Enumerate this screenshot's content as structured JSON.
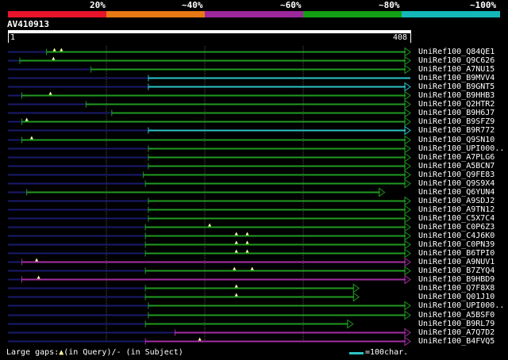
{
  "legend": {
    "labels": [
      "20%",
      "~40%",
      "~60%",
      "~80%",
      "~100%"
    ],
    "colors": [
      "#e8142c",
      "#e87814",
      "#9c289c",
      "#14a014",
      "#14b8b8"
    ]
  },
  "query": {
    "name": "AV410913",
    "start": "1",
    "end": "408",
    "length": 408
  },
  "colors": {
    "red": "#e8142c",
    "orange": "#e87814",
    "purple": "#a52ea5",
    "green": "#1f9a1f",
    "cyan": "#2cc3c8",
    "navy": "#1a1a6e",
    "marker": "#ffffa0"
  },
  "hits": [
    {
      "label": "UniRef100_Q84QE1",
      "color": "green",
      "start": 40,
      "end": 408,
      "arrow": "right",
      "markers": [
        48,
        55
      ]
    },
    {
      "label": "UniRef100_Q9C626",
      "color": "green",
      "start": 13,
      "end": 408,
      "arrow": "right",
      "markers": [
        47
      ]
    },
    {
      "label": "UniRef100_A7NU15",
      "color": "green",
      "start": 85,
      "end": 408,
      "arrow": "right",
      "markers": []
    },
    {
      "label": "UniRef100_B9MVV4",
      "color": "cyan",
      "start": 143,
      "end": 408,
      "arrow": "none",
      "markers": []
    },
    {
      "label": "UniRef100_B9GNT5",
      "color": "cyan",
      "start": 143,
      "end": 408,
      "arrow": "right",
      "markers": []
    },
    {
      "label": "UniRef100_B9HHB3",
      "color": "green",
      "start": 15,
      "end": 408,
      "arrow": "right",
      "markers": [
        44
      ]
    },
    {
      "label": "UniRef100_Q2HTR2",
      "color": "green",
      "start": 80,
      "end": 408,
      "arrow": "right",
      "markers": []
    },
    {
      "label": "UniRef100_B9H6J7",
      "color": "green",
      "start": 106,
      "end": 408,
      "arrow": "right",
      "markers": []
    },
    {
      "label": "UniRef100_B9SFZ9",
      "color": "green",
      "start": 15,
      "end": 408,
      "arrow": "right",
      "markers": [
        20
      ]
    },
    {
      "label": "UniRef100_B9R772",
      "color": "cyan",
      "start": 143,
      "end": 408,
      "arrow": "right",
      "markers": []
    },
    {
      "label": "UniRef100_Q9SN10",
      "color": "green",
      "start": 15,
      "end": 408,
      "arrow": "right",
      "markers": [
        25
      ]
    },
    {
      "label": "UniRef100_UPI000..",
      "color": "green",
      "start": 143,
      "end": 408,
      "arrow": "right",
      "markers": []
    },
    {
      "label": "UniRef100_A7PLG6",
      "color": "green",
      "start": 143,
      "end": 408,
      "arrow": "right",
      "markers": []
    },
    {
      "label": "UniRef100_A5BCN7",
      "color": "green",
      "start": 143,
      "end": 408,
      "arrow": "right",
      "markers": []
    },
    {
      "label": "UniRef100_Q9FE83",
      "color": "green",
      "start": 138,
      "end": 408,
      "arrow": "right",
      "markers": []
    },
    {
      "label": "UniRef100_Q9S9X4",
      "color": "green",
      "start": 140,
      "end": 408,
      "arrow": "right",
      "markers": []
    },
    {
      "label": "UniRef100_Q6YUN4",
      "color": "green",
      "start": 20,
      "end": 382,
      "arrow": "right",
      "markers": []
    },
    {
      "label": "UniRef100_A9SDJ2",
      "color": "green",
      "start": 143,
      "end": 408,
      "arrow": "right",
      "markers": []
    },
    {
      "label": "UniRef100_A9TN12",
      "color": "green",
      "start": 143,
      "end": 408,
      "arrow": "right",
      "markers": []
    },
    {
      "label": "UniRef100_C5X7C4",
      "color": "green",
      "start": 143,
      "end": 408,
      "arrow": "right",
      "markers": []
    },
    {
      "label": "UniRef100_C0P6Z3",
      "color": "green",
      "start": 140,
      "end": 408,
      "arrow": "right",
      "markers": [
        205
      ]
    },
    {
      "label": "UniRef100_C4J6K0",
      "color": "green",
      "start": 140,
      "end": 408,
      "arrow": "right",
      "markers": [
        232,
        243
      ]
    },
    {
      "label": "UniRef100_C0PN39",
      "color": "green",
      "start": 140,
      "end": 408,
      "arrow": "right",
      "markers": [
        232,
        243
      ]
    },
    {
      "label": "UniRef100_B6TPI0",
      "color": "green",
      "start": 140,
      "end": 408,
      "arrow": "right",
      "markers": [
        232,
        243
      ]
    },
    {
      "label": "UniRef100_A9NUV1",
      "color": "purple",
      "start": 15,
      "end": 408,
      "arrow": "right",
      "markers": [
        30
      ]
    },
    {
      "label": "UniRef100_B7ZYQ4",
      "color": "green",
      "start": 140,
      "end": 408,
      "arrow": "right",
      "markers": [
        230,
        248
      ]
    },
    {
      "label": "UniRef100_B9HBD9",
      "color": "purple",
      "start": 15,
      "end": 408,
      "arrow": "right",
      "markers": [
        32
      ]
    },
    {
      "label": "UniRef100_Q7F8X8",
      "color": "green",
      "start": 140,
      "end": 356,
      "arrow": "right",
      "markers": [
        232
      ]
    },
    {
      "label": "UniRef100_Q01J10",
      "color": "green",
      "start": 140,
      "end": 356,
      "arrow": "right",
      "markers": [
        232
      ]
    },
    {
      "label": "UniRef100_UPI000..",
      "color": "green",
      "start": 143,
      "end": 408,
      "arrow": "right",
      "markers": []
    },
    {
      "label": "UniRef100_A5BSF0",
      "color": "green",
      "start": 143,
      "end": 408,
      "arrow": "right",
      "markers": []
    },
    {
      "label": "UniRef100_B9RL79",
      "color": "green",
      "start": 140,
      "end": 350,
      "arrow": "right",
      "markers": []
    },
    {
      "label": "UniRef100_A7Q7D2",
      "color": "purple",
      "start": 170,
      "end": 408,
      "arrow": "right",
      "markers": []
    },
    {
      "label": "UniRef100_B4FVQ5",
      "color": "purple",
      "start": 140,
      "end": 408,
      "arrow": "right",
      "markers": [
        195
      ]
    }
  ],
  "footer": {
    "gaps_prefix": "Large gaps:",
    "gaps_query": "(in Query)/",
    "gaps_dash": "-",
    "gaps_subject": " (in Subject)",
    "scale_text": "=100char."
  }
}
